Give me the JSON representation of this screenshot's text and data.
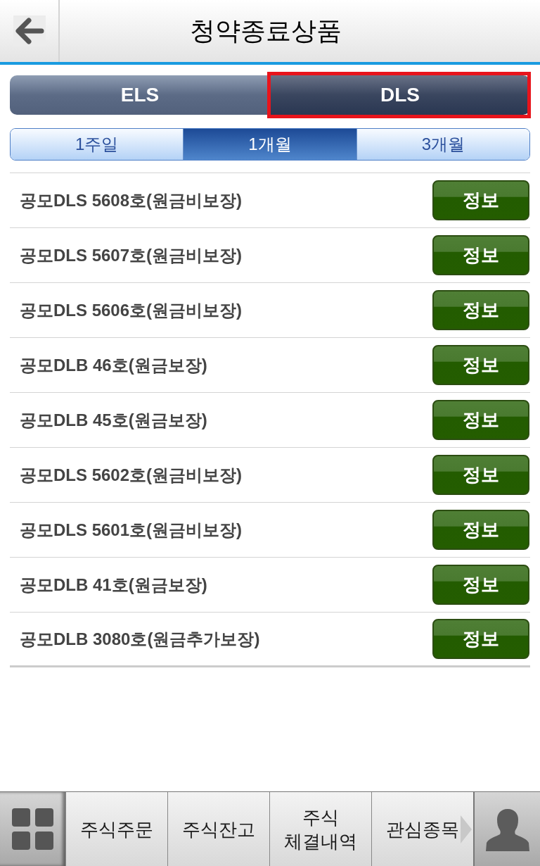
{
  "header": {
    "title": "청약종료상품"
  },
  "product_tabs": [
    {
      "label": "ELS",
      "selected": false,
      "highlighted": false
    },
    {
      "label": "DLS",
      "selected": true,
      "highlighted": true
    }
  ],
  "period_tabs": [
    {
      "label": "1주일",
      "selected": false
    },
    {
      "label": "1개월",
      "selected": true
    },
    {
      "label": "3개월",
      "selected": false
    }
  ],
  "products": [
    {
      "name": "공모DLS 5608호(원금비보장)",
      "button": "정보"
    },
    {
      "name": "공모DLS 5607호(원금비보장)",
      "button": "정보"
    },
    {
      "name": "공모DLS 5606호(원금비보장)",
      "button": "정보"
    },
    {
      "name": "공모DLB 46호(원금보장)",
      "button": "정보"
    },
    {
      "name": "공모DLB 45호(원금보장)",
      "button": "정보"
    },
    {
      "name": "공모DLS 5602호(원금비보장)",
      "button": "정보"
    },
    {
      "name": "공모DLS 5601호(원금비보장)",
      "button": "정보"
    },
    {
      "name": "공모DLB 41호(원금보장)",
      "button": "정보"
    },
    {
      "name": "공모DLB 3080호(원금추가보장)",
      "button": "정보"
    }
  ],
  "bottom_bar": {
    "tabs": [
      {
        "label": "주식주문"
      },
      {
        "label": "주식잔고"
      },
      {
        "label": "주식\n체결내역"
      },
      {
        "label": "관심종목"
      }
    ]
  }
}
